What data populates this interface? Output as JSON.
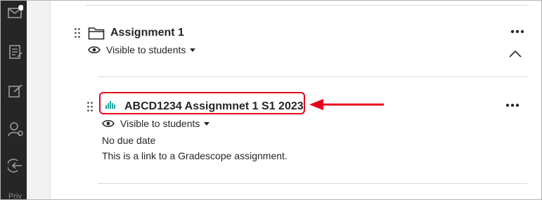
{
  "sidebar": {
    "icons": [
      "mail-icon",
      "document-icon",
      "edit-icon",
      "user-settings-icon",
      "sign-out-icon"
    ],
    "footer_text": "Priv"
  },
  "folder": {
    "title": "Assignment 1",
    "visibility": "Visible to students",
    "more_label": "•••"
  },
  "item": {
    "title": "ABCD1234 Assignmnet 1 S1 2023",
    "visibility": "Visible to students",
    "due": "No due date",
    "description": "This is a link to a Gradescope assignment.",
    "more_label": "•••"
  },
  "colors": {
    "highlight": "#e8001c",
    "gradescope_teal": "#1ba39c",
    "sidebar": "#262626"
  }
}
